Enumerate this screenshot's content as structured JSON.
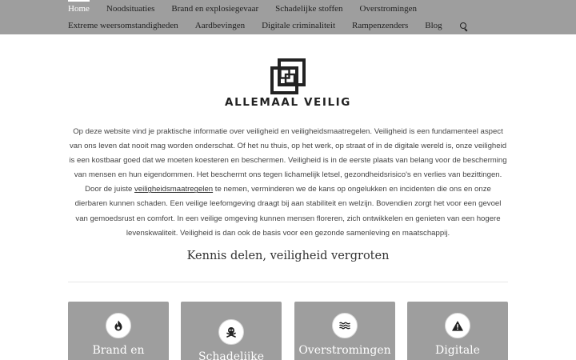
{
  "nav": {
    "row1": [
      "Home",
      "Noodsituaties",
      "Brand en explosiegevaar",
      "Schadelijke stoffen",
      "Overstromingen"
    ],
    "row2": [
      "Extreme weersomstandigheden",
      "Aardbevingen",
      "Digitale criminaliteit",
      "Rampenzenders",
      "Blog"
    ],
    "search_icon": "search-icon"
  },
  "brand": {
    "name": "ALLEMAAL VEILIG"
  },
  "intro": {
    "before_link": "Op deze website vind je praktische informatie over veiligheid en veiligheidsmaatregelen. Veiligheid is een fundamenteel aspect van ons leven dat nooit mag worden onderschat. Of het nu thuis, op het werk, op straat of in de digitale wereld is, onze veiligheid is een kostbaar goed dat we moeten koesteren en beschermen. Veiligheid is in de eerste plaats van belang voor de bescherming van mensen en hun eigendommen. Het beschermt ons tegen lichamelijk letsel, gezondheidsrisico's en verlies van bezittingen. Door de juiste ",
    "link": "veiligheidsmaatregelen",
    "after_link": " te nemen, verminderen we de kans op ongelukken en incidenten die ons en onze dierbaren kunnen schaden. Een veilige leefomgeving draagt bij aan stabiliteit en welzijn. Bovendien zorgt het voor een gevoel van gemoedsrust en comfort. In een veilige omgeving kunnen mensen floreren, zich ontwikkelen en genieten van een hogere levenskwaliteit. Veiligheid is dan ook de basis voor een gezonde samenleving en maatschappij."
  },
  "tagline": "Kennis delen, veiligheid vergroten",
  "cards": [
    {
      "title": "Brand en",
      "icon": "fire-icon"
    },
    {
      "title": "Schadelijke",
      "icon": "skull-crossbones-icon"
    },
    {
      "title": "Overstromingen",
      "icon": "water-waves-icon"
    },
    {
      "title": "Digitale",
      "icon": "warning-triangle-icon"
    }
  ],
  "colors": {
    "nav_bg": "#9e9e9e",
    "card_bg": "#9e9e9e",
    "active": "#ffffff",
    "text": "#333333"
  }
}
